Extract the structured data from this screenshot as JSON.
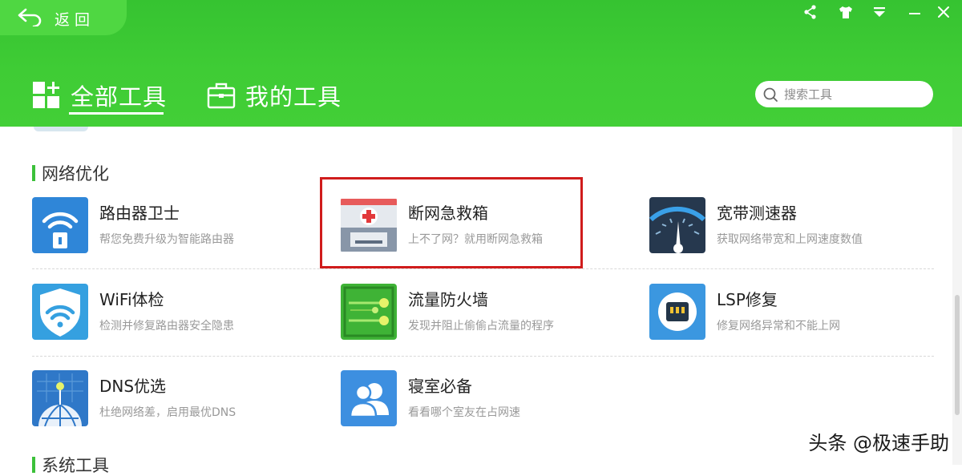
{
  "header": {
    "back_label": "返回",
    "tabs": [
      {
        "label": "全部工具",
        "active": true
      },
      {
        "label": "我的工具",
        "active": false
      }
    ],
    "search": {
      "placeholder": "搜索工具"
    },
    "window_controls": [
      "share-icon",
      "skin-icon",
      "menu-icon",
      "minimize-icon",
      "close-icon"
    ]
  },
  "section": {
    "title": "网络优化"
  },
  "next_section": {
    "title": "系统工具"
  },
  "tools": [
    {
      "name": "路由器卫士",
      "desc": "帮您免费升级为智能路由器",
      "icon": "router-guard-icon"
    },
    {
      "name": "断网急救箱",
      "desc": "上不了网？就用断网急救箱",
      "icon": "first-aid-kit-icon",
      "highlighted": true
    },
    {
      "name": "宽带测速器",
      "desc": "获取网络带宽和上网速度数值",
      "icon": "speedometer-icon"
    },
    {
      "name": "WiFi体检",
      "desc": "检测并修复路由器安全隐患",
      "icon": "wifi-shield-icon"
    },
    {
      "name": "流量防火墙",
      "desc": "发现并阻止偷偷占流量的程序",
      "icon": "traffic-firewall-icon"
    },
    {
      "name": "LSP修复",
      "desc": "修复网络异常和不能上网",
      "icon": "lsp-repair-icon"
    },
    {
      "name": "DNS优选",
      "desc": "杜绝网络差，启用最优DNS",
      "icon": "dns-globe-icon"
    },
    {
      "name": "寝室必备",
      "desc": "看看哪个室友在占网速",
      "icon": "roommates-icon"
    }
  ],
  "watermark": "头条 @极速手助",
  "colors": {
    "header_green": "#3fcc35",
    "accent_green": "#3cc13a",
    "highlight_red": "#d01c1c"
  }
}
